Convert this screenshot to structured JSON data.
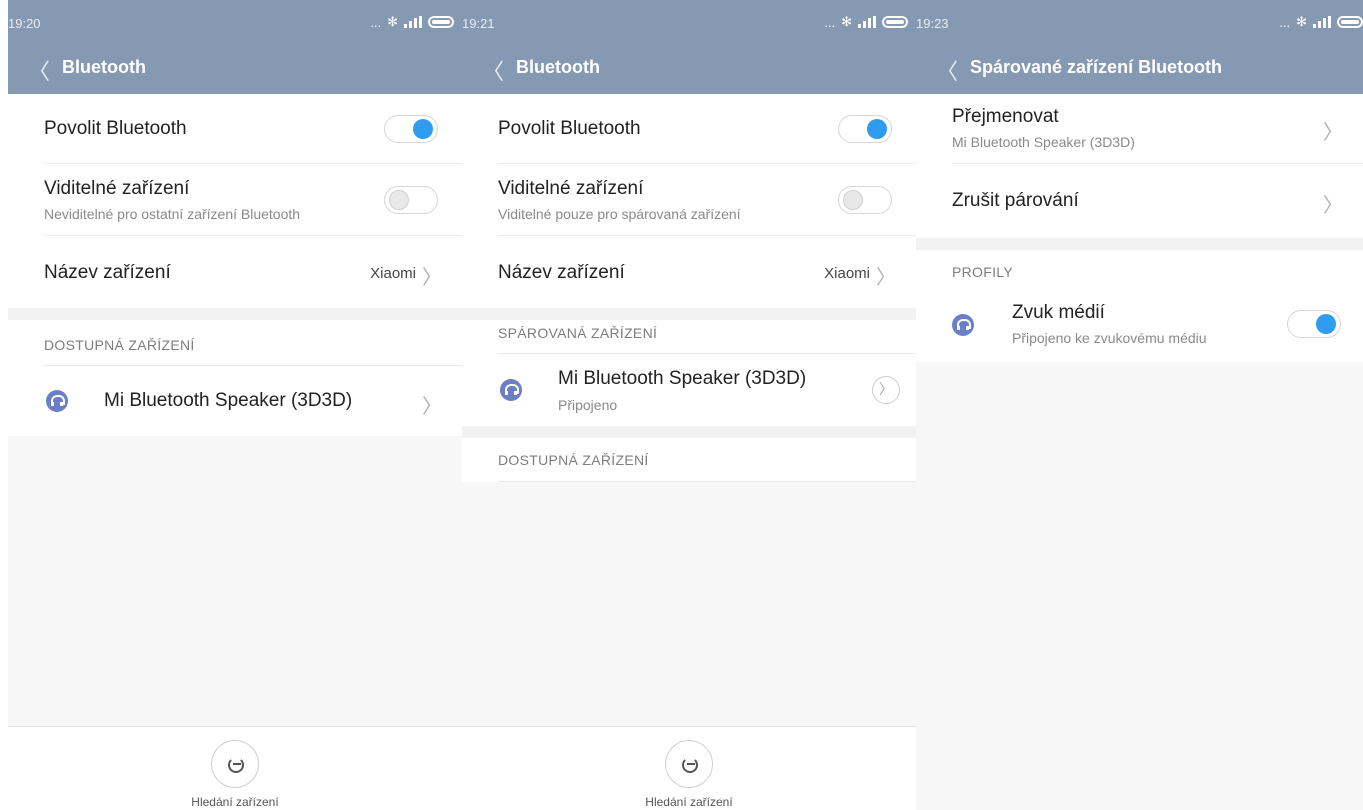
{
  "screen1": {
    "time": "19:20",
    "title": "Bluetooth",
    "enable_label": "Povolit Bluetooth",
    "visible_label": "Viditelné zařízení",
    "visible_sub": "Neviditelné pro ostatní zařízení Bluetooth",
    "name_label": "Název zařízení",
    "name_value": "Xiaomi",
    "available_header": "DOSTUPNÁ ZAŘÍZENÍ",
    "device_name": "Mi Bluetooth Speaker (3D3D)",
    "scan_label": "Hledání zařízení"
  },
  "screen2": {
    "time": "19:21",
    "title": "Bluetooth",
    "enable_label": "Povolit Bluetooth",
    "visible_label": "Viditelné zařízení",
    "visible_sub": "Viditelné pouze pro spárovaná zařízení",
    "name_label": "Název zařízení",
    "name_value": "Xiaomi",
    "paired_header": "SPÁROVANÁ ZAŘÍZENÍ",
    "device_name": "Mi Bluetooth Speaker (3D3D)",
    "device_status": "Připojeno",
    "available_header": "DOSTUPNÁ ZAŘÍZENÍ",
    "scan_label": "Hledání zařízení"
  },
  "screen3": {
    "time": "19:23",
    "title": "Spárované zařízení Bluetooth",
    "rename_label": "Přejmenovat",
    "rename_sub": "Mi Bluetooth Speaker (3D3D)",
    "unpair_label": "Zrušit párování",
    "profiles_header": "PROFILY",
    "media_label": "Zvuk médií",
    "media_sub": "Připojeno ke zvukovému médiu"
  },
  "status_icons": {
    "dots": "...",
    "bluetooth": "✻"
  },
  "colors": {
    "header": "#8699b3",
    "toggle_on": "#2f9cf0",
    "device_icon": "#6b7fc9"
  }
}
